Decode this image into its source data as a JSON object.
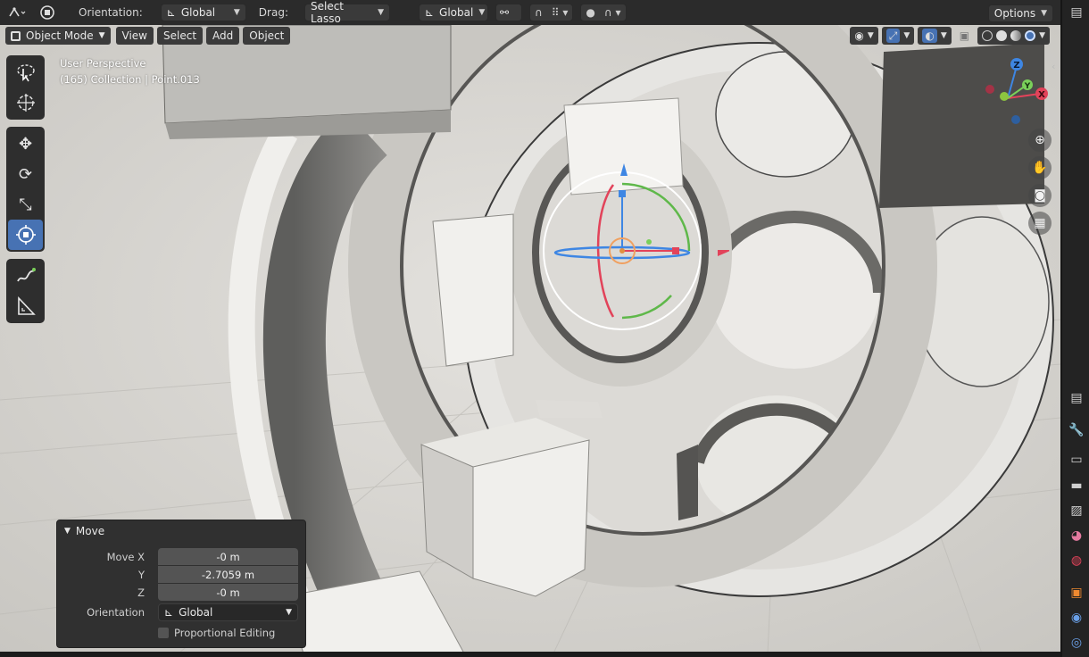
{
  "header": {
    "editor_type_icon": "object-transform-icon",
    "pivot_icon": "pivot-point-icon",
    "orientation_label": "Orientation:",
    "orientation_value": "Global",
    "drag_label": "Drag:",
    "drag_value": "Select Lasso",
    "transform_orientation": "Global",
    "options_label": "Options"
  },
  "viewport_header": {
    "mode": "Object Mode",
    "menus": [
      "View",
      "Select",
      "Add",
      "Object"
    ]
  },
  "overlay": {
    "perspective": "User Perspective",
    "context": "(165) Collection | Point.013"
  },
  "toolbar": {
    "tools": [
      "select-lasso",
      "cursor",
      "move",
      "rotate",
      "scale",
      "transform",
      "annotate",
      "measure"
    ],
    "active": "transform"
  },
  "gizmo": {
    "axes": [
      "X",
      "Y",
      "Z"
    ],
    "colors": {
      "x": "#e2435a",
      "y": "#8dc63f",
      "z": "#3e86e3"
    }
  },
  "operator_panel": {
    "title": "Move",
    "move_x_label": "Move X",
    "move_x": "-0 m",
    "y_label": "Y",
    "y": "-2.7059 m",
    "z_label": "Z",
    "z": "-0 m",
    "orientation_label": "Orientation",
    "orientation_value": "Global",
    "proportional_label": "Proportional Editing",
    "proportional_checked": false
  },
  "colors": {
    "accent": "#4772b3",
    "header_bg": "#2b2b2b",
    "viewport_bg": "#d9d7d3"
  }
}
